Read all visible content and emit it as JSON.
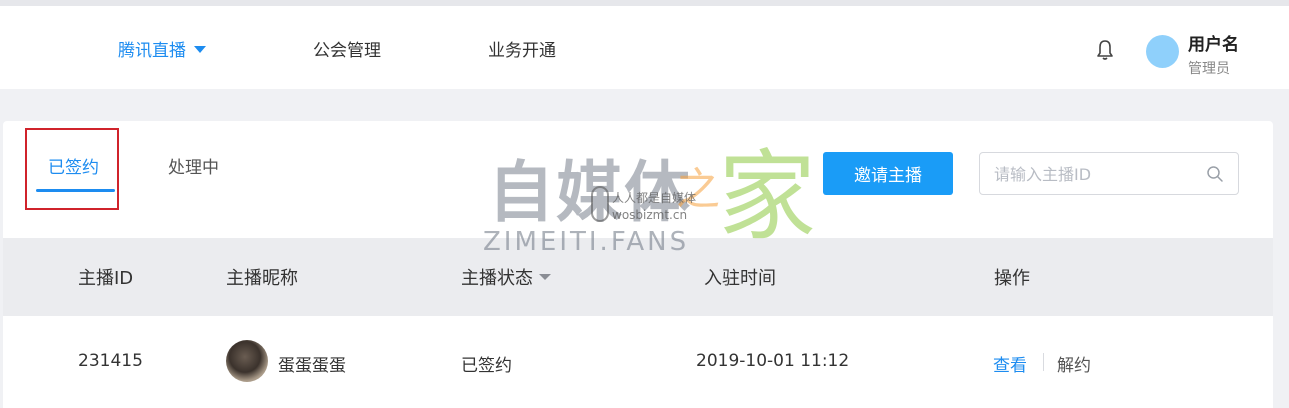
{
  "nav": {
    "items": [
      {
        "label": "腾讯直播",
        "active": true
      },
      {
        "label": "公会管理",
        "active": false
      },
      {
        "label": "业务开通",
        "active": false
      }
    ]
  },
  "user": {
    "name": "用户名",
    "role": "管理员"
  },
  "tabs": [
    {
      "label": "已签约",
      "active": true
    },
    {
      "label": "处理中",
      "active": false
    }
  ],
  "toolbar": {
    "invite_label": "邀请主播",
    "search_placeholder": "请输入主播ID"
  },
  "table": {
    "headers": [
      "主播ID",
      "主播昵称",
      "主播状态",
      "入驻时间",
      "操作"
    ],
    "rows": [
      {
        "id": "231415",
        "nickname": "蛋蛋蛋蛋",
        "status": "已签约",
        "joined": "2019-10-01 11:12",
        "actions": [
          "查看",
          "解约"
        ]
      }
    ]
  },
  "watermark": {
    "cn": "自媒体",
    "zhi": "之",
    "jia": "家",
    "en": "ZIMEITI.FANS",
    "slogan": "人人都是自媒体",
    "domain": "wosbizmt.cn"
  },
  "colors": {
    "accent": "#1d8cf0",
    "button": "#1a9cf7",
    "highlight_box": "#d0232b"
  },
  "icons": {
    "bell": "bell-icon",
    "search": "search-icon",
    "dropdown": "caret-down-icon"
  }
}
